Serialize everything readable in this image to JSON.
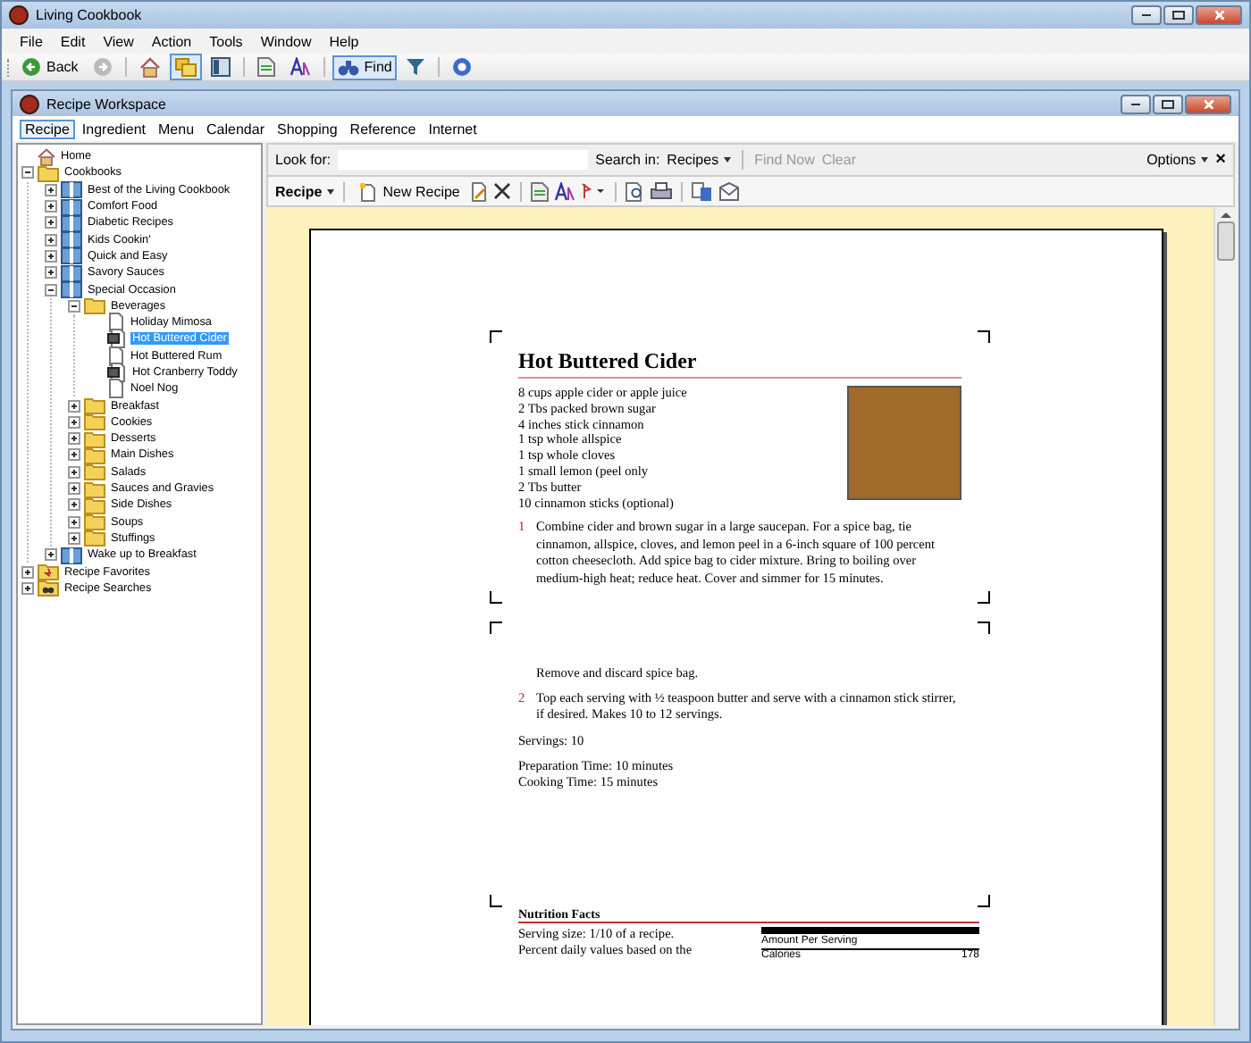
{
  "app_window": {
    "title": "Living Cookbook"
  },
  "menu_bar": [
    "File",
    "Edit",
    "View",
    "Action",
    "Tools",
    "Window",
    "Help"
  ],
  "toolbar": [
    {
      "kind": "back",
      "label": "Back",
      "pressed": false
    },
    {
      "kind": "forward",
      "pressed": false
    },
    {
      "kind": "home",
      "pressed": false
    },
    {
      "kind": "folders",
      "pressed": true
    },
    {
      "kind": "panel",
      "pressed": false
    },
    {
      "kind": "note",
      "pressed": false
    },
    {
      "kind": "font",
      "pressed": false
    },
    {
      "kind": "find",
      "label": "Find",
      "pressed": true
    },
    {
      "kind": "filter",
      "pressed": false
    },
    {
      "kind": "help",
      "pressed": false
    }
  ],
  "workspace": {
    "title": "Recipe Workspace",
    "tabs": [
      {
        "label": "Recipe",
        "selected": true
      },
      {
        "label": "Ingredient",
        "selected": false
      },
      {
        "label": "Menu",
        "selected": false
      },
      {
        "label": "Calendar",
        "selected": false
      },
      {
        "label": "Shopping",
        "selected": false
      },
      {
        "label": "Reference",
        "selected": false
      },
      {
        "label": "Internet",
        "selected": false
      }
    ]
  },
  "tree": [
    {
      "label": "Home",
      "kind": "home",
      "selected": false
    },
    {
      "label": "Cookbooks",
      "kind": "folder",
      "selected": false,
      "expanded": true,
      "children": [
        {
          "label": "Best of the Living Cookbook",
          "kind": "cookbook",
          "selected": false,
          "expanded": false
        },
        {
          "label": "Comfort Food",
          "kind": "cookbook",
          "selected": false,
          "expanded": false
        },
        {
          "label": "Diabetic Recipes",
          "kind": "cookbook",
          "selected": false,
          "expanded": false
        },
        {
          "label": "Kids Cookin'",
          "kind": "cookbook",
          "selected": false,
          "expanded": false
        },
        {
          "label": "Quick and Easy",
          "kind": "cookbook",
          "selected": false,
          "expanded": false
        },
        {
          "label": "Savory Sauces",
          "kind": "cookbook",
          "selected": false,
          "expanded": false
        },
        {
          "label": "Special Occasion",
          "kind": "cookbook",
          "selected": false,
          "expanded": true,
          "children": [
            {
              "label": "Beverages",
              "kind": "folder",
              "selected": false,
              "expanded": true,
              "children": [
                {
                  "label": "Holiday Mimosa",
                  "kind": "recipe",
                  "selected": false
                },
                {
                  "label": "Hot Buttered Cider",
                  "kind": "photo-recipe",
                  "selected": true
                },
                {
                  "label": "Hot Buttered Rum",
                  "kind": "recipe",
                  "selected": false
                },
                {
                  "label": "Hot Cranberry Toddy",
                  "kind": "photo-recipe",
                  "selected": false
                },
                {
                  "label": "Noel Nog",
                  "kind": "recipe",
                  "selected": false
                }
              ]
            },
            {
              "label": "Breakfast",
              "kind": "folder",
              "selected": false,
              "expanded": false
            },
            {
              "label": "Cookies",
              "kind": "folder",
              "selected": false,
              "expanded": false
            },
            {
              "label": "Desserts",
              "kind": "folder",
              "selected": false,
              "expanded": false
            },
            {
              "label": "Main Dishes",
              "kind": "folder",
              "selected": false,
              "expanded": false
            },
            {
              "label": "Salads",
              "kind": "folder",
              "selected": false,
              "expanded": false
            },
            {
              "label": "Sauces and Gravies",
              "kind": "folder",
              "selected": false,
              "expanded": false
            },
            {
              "label": "Side Dishes",
              "kind": "folder",
              "selected": false,
              "expanded": false
            },
            {
              "label": "Soups",
              "kind": "folder",
              "selected": false,
              "expanded": false
            },
            {
              "label": "Stuffings",
              "kind": "folder",
              "selected": false,
              "expanded": false
            }
          ]
        },
        {
          "label": "Wake up to Breakfast",
          "kind": "cookbook",
          "selected": false,
          "expanded": false
        }
      ]
    },
    {
      "label": "Recipe Favorites",
      "kind": "favorites",
      "selected": false,
      "expanded": false
    },
    {
      "label": "Recipe Searches",
      "kind": "searches",
      "selected": false,
      "expanded": false
    }
  ],
  "search_bar": {
    "look_for_label": "Look for:",
    "search_in_label": "Search in:",
    "search_in_value": "Recipes",
    "buttons": [
      {
        "label": "Find Now",
        "disabled": true
      },
      {
        "label": "Clear",
        "disabled": true
      }
    ],
    "options": "Options",
    "close": "×"
  },
  "recipe_toolbar": {
    "menu": "Recipe",
    "new_recipe": "New Recipe"
  },
  "recipe": {
    "title": "Hot Buttered Cider",
    "ingredients": [
      "8 cups apple cider or apple juice",
      "2 Tbs packed brown sugar",
      "4 inches stick cinnamon",
      "1 tsp whole allspice",
      "1 tsp whole cloves",
      "1 small lemon (peel only",
      "2 Tbs butter",
      "10 cinnamon sticks (optional)"
    ],
    "steps": [
      {
        "number": "1",
        "text": "Combine cider and brown sugar in a large saucepan. For a spice bag, tie cinnamon, allspice, cloves, and lemon peel in a 6-inch square of 100 percent cotton cheesecloth. Add spice bag to cider mixture. Bring to boiling over medium-high heat; reduce heat. Cover and simmer for 15 minutes."
      }
    ],
    "continued_steps": [
      {
        "text": "Remove and discard spice bag."
      },
      {
        "number": "2",
        "text": "Top each serving with ½ teaspoon butter and serve with a cinnamon stick stirrer, if desired. Makes 10 to 12 servings."
      }
    ],
    "servings": "Servings: 10",
    "prep_time": "Preparation Time: 10 minutes",
    "cook_time": "Cooking Time: 15 minutes",
    "nutrition": {
      "title": "Nutrition Facts",
      "serving_size": "Serving size: 1/10 of a recipe.",
      "percent_note": "Percent daily values based on the",
      "amount_per_serving": "Amount Per Serving",
      "calories_label": "Calories",
      "calories_value": "178"
    }
  }
}
